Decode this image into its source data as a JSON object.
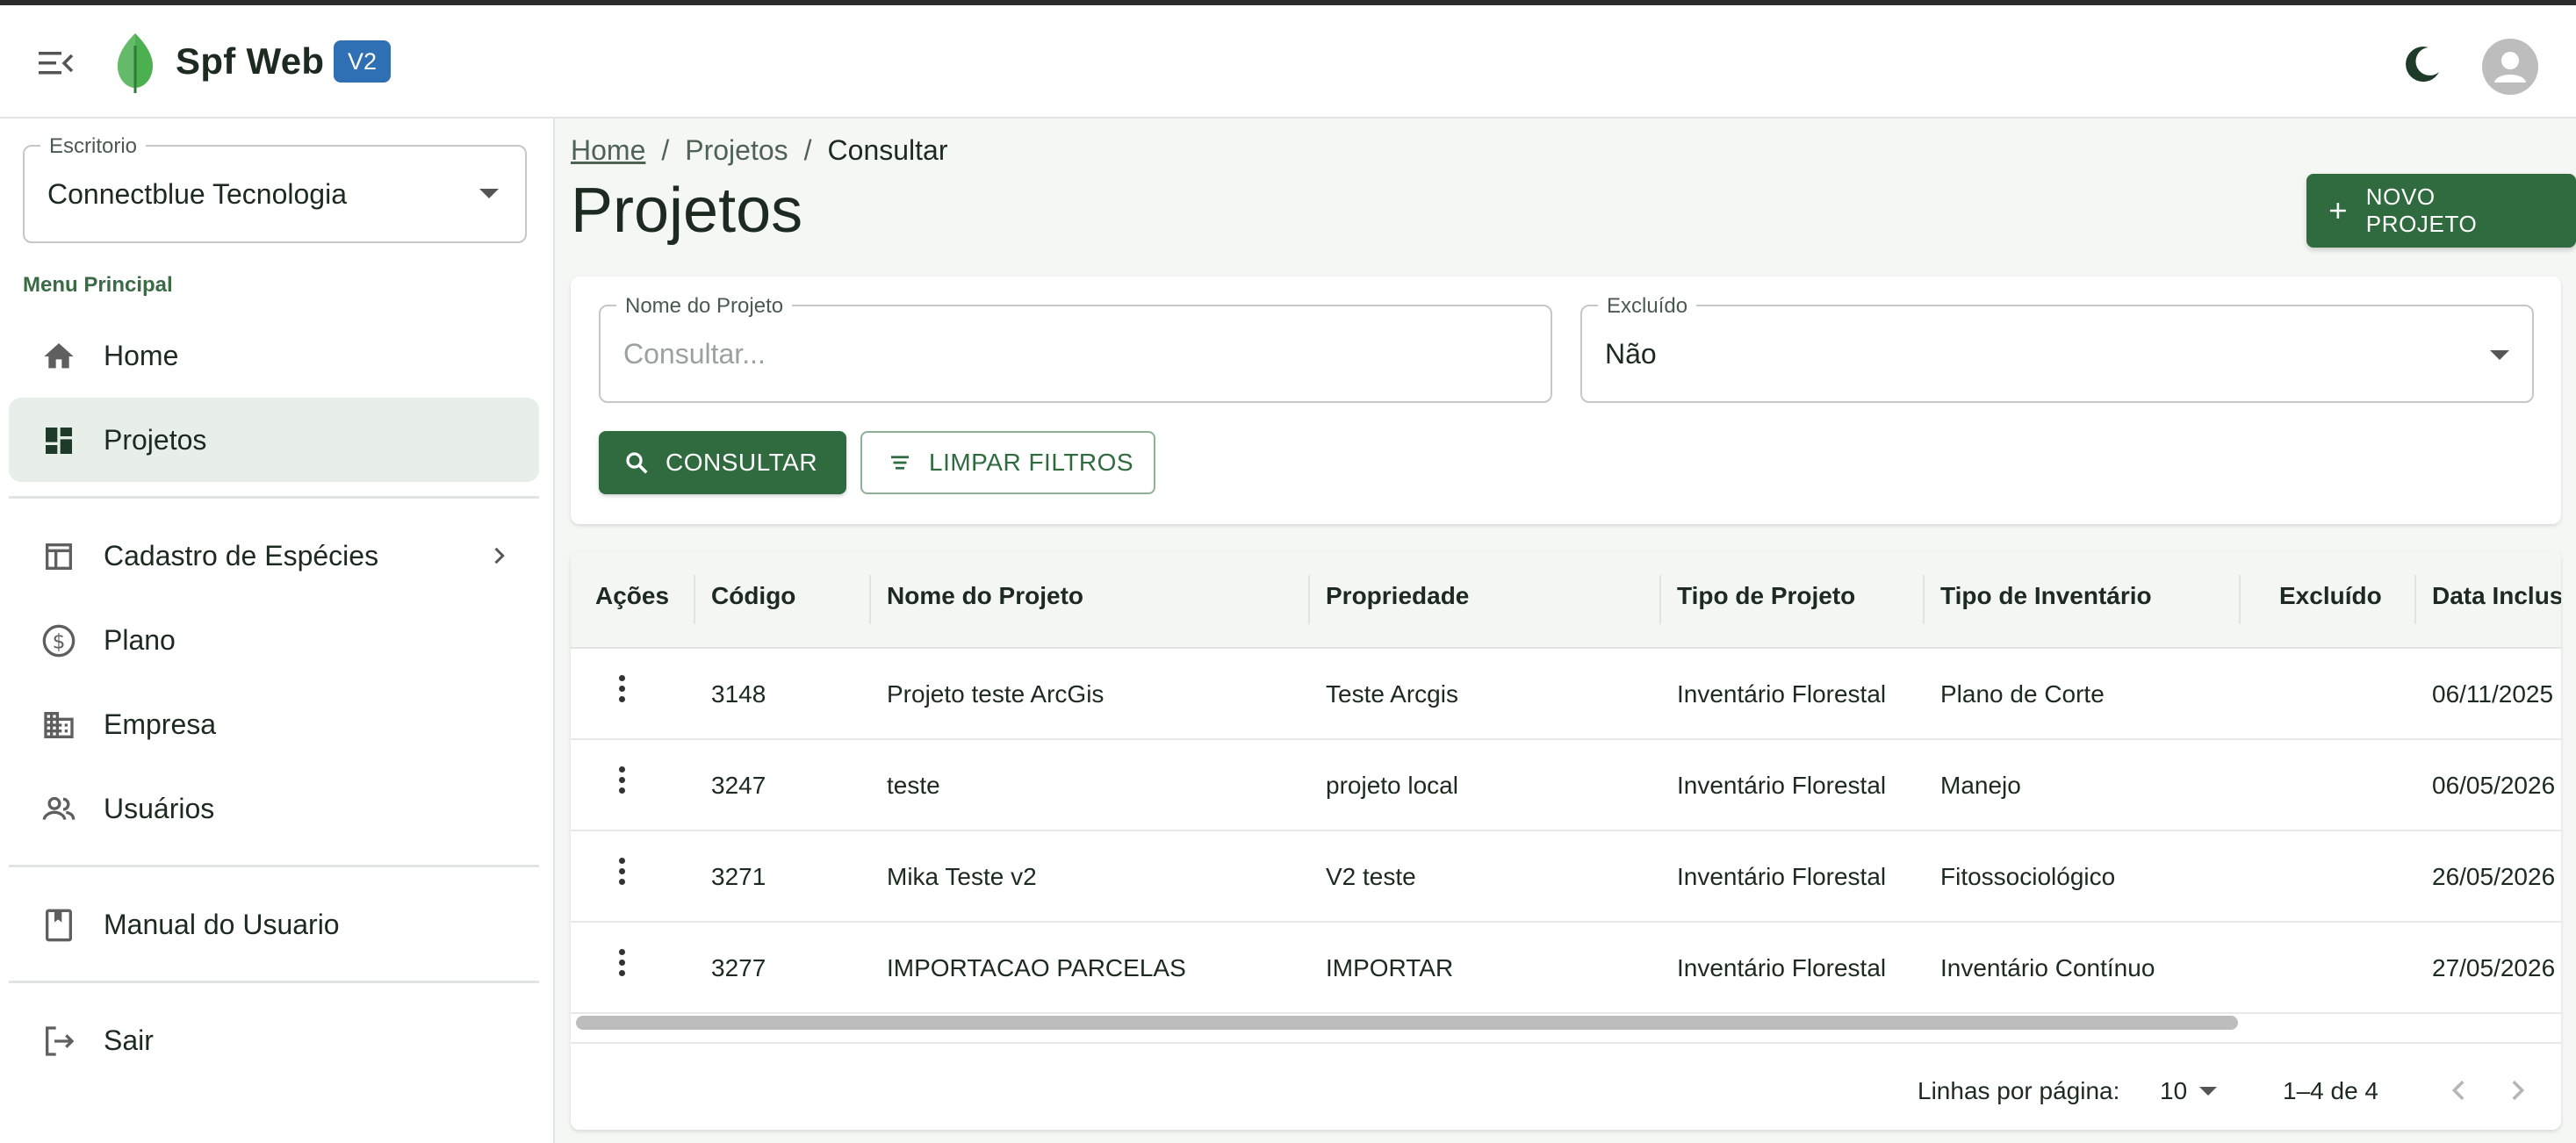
{
  "app": {
    "title": "Spf Web",
    "version": "V2",
    "accent_color": "#2f6b3f",
    "badge_color": "#2f6fb3"
  },
  "sidebar": {
    "office_label": "Escritorio",
    "office_value": "Connectblue Tecnologia",
    "section_label": "Menu Principal",
    "items": [
      {
        "label": "Home",
        "icon": "home-icon"
      },
      {
        "label": "Projetos",
        "icon": "dashboard-icon",
        "active": true
      },
      {
        "label": "Cadastro de Espécies",
        "icon": "table-icon"
      },
      {
        "label": "Plano",
        "icon": "dollar-icon"
      },
      {
        "label": "Empresa",
        "icon": "building-icon"
      },
      {
        "label": "Usuários",
        "icon": "users-icon"
      },
      {
        "label": "Manual do Usuario",
        "icon": "book-icon"
      },
      {
        "label": "Sair",
        "icon": "logout-icon"
      }
    ]
  },
  "breadcrumb": {
    "home": "Home",
    "projects": "Projetos",
    "current": "Consultar",
    "separator": "/"
  },
  "page": {
    "title": "Projetos",
    "new_button": "NOVO PROJETO"
  },
  "filters": {
    "name_label": "Nome do Projeto",
    "name_placeholder": "Consultar...",
    "deleted_label": "Excluído",
    "deleted_value": "Não",
    "search_button": "CONSULTAR",
    "clear_button": "LIMPAR FILTROS"
  },
  "table": {
    "columns": [
      "Ações",
      "Código",
      "Nome do Projeto",
      "Propriedade",
      "Tipo de Projeto",
      "Tipo de Inventário",
      "Excluído",
      "Data Inclus"
    ],
    "rows": [
      {
        "code": "3148",
        "name": "Projeto teste ArcGis",
        "property": "Teste Arcgis",
        "project_type": "Inventário Florestal",
        "inventory_type": "Plano de Corte",
        "deleted": "",
        "date": "06/11/2025"
      },
      {
        "code": "3247",
        "name": "teste",
        "property": "projeto local",
        "project_type": "Inventário Florestal",
        "inventory_type": "Manejo",
        "deleted": "",
        "date": "06/05/2026"
      },
      {
        "code": "3271",
        "name": "Mika Teste v2",
        "property": "V2 teste",
        "project_type": "Inventário Florestal",
        "inventory_type": "Fitossociológico",
        "deleted": "",
        "date": "26/05/2026"
      },
      {
        "code": "3277",
        "name": "IMPORTACAO PARCELAS",
        "property": "IMPORTAR",
        "project_type": "Inventário Florestal",
        "inventory_type": "Inventário Contínuo",
        "deleted": "",
        "date": "27/05/2026"
      }
    ]
  },
  "pagination": {
    "rows_per_page_label": "Linhas por página:",
    "rows_per_page_value": "10",
    "range": "1–4 de 4"
  }
}
